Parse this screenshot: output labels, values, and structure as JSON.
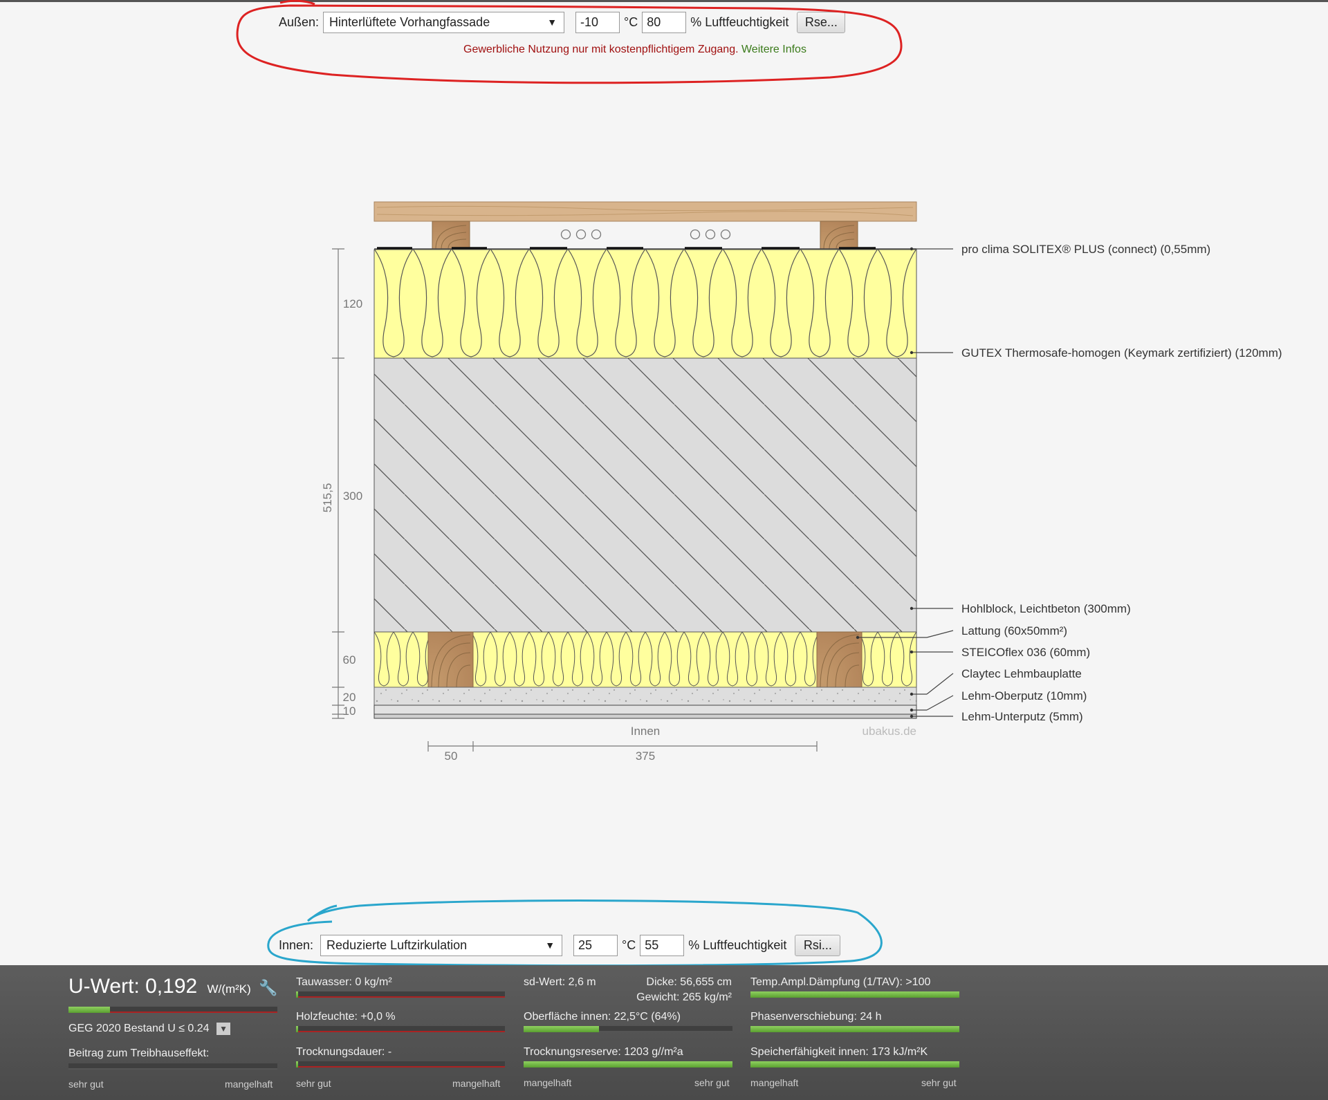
{
  "outside": {
    "label": "Außen:",
    "condition": "Hinterlüftete Vorhangfassade",
    "temperature": "-10",
    "temp_unit": "°C",
    "humidity": "80",
    "humidity_label": "% Luftfeuchtigkeit",
    "button": "Rse..."
  },
  "notice": {
    "text": "Gewerbliche Nutzung nur mit kostenpflichtigem Zugang.",
    "link": "Weitere Infos"
  },
  "diagram": {
    "layers": [
      "pro clima SOLITEX® PLUS (connect) (0,55mm)",
      "GUTEX Thermosafe-homogen  (Keymark zertifiziert) (120mm)",
      "Hohlblock, Leichtbeton (300mm)",
      "Lattung (60x50mm²)",
      "STEICOflex 036 (60mm)",
      "Claytec Lehmbauplatte",
      "Lehm-Oberputz (10mm)",
      "Lehm-Unterputz (5mm)"
    ],
    "dims_vertical": {
      "total": "515,5",
      "d120": "120",
      "d300": "300",
      "d60": "60",
      "d20": "20",
      "d10": "10"
    },
    "dims_horizontal": {
      "d50": "50",
      "d375": "375"
    },
    "inside_label": "Innen",
    "watermark": "ubakus.de"
  },
  "inside": {
    "label": "Innen:",
    "condition": "Reduzierte Luftzirkulation",
    "temperature": "25",
    "temp_unit": "°C",
    "humidity": "55",
    "humidity_label": "% Luftfeuchtigkeit",
    "button": "Rsi..."
  },
  "results": {
    "uwert_label": "U-Wert:",
    "uwert_value": "0,192",
    "uwert_unit": "W/(m²K)",
    "uwert_fill": 0.2,
    "geg": "GEG 2020 Bestand U ≤ 0.24",
    "treibhaus": "Beitrag zum Treibhauseffekt:",
    "tauwasser": "Tauwasser: 0 kg/m²",
    "holzfeuchte": "Holzfeuchte: +0,0 %",
    "trocknungsdauer": "Trocknungsdauer: -",
    "sdwert": "sd-Wert: 2,6 m",
    "dicke": "Dicke: 56,655 cm",
    "gewicht": "Gewicht: 265 kg/m²",
    "oberflaeche": "Oberfläche innen: 22,5°C (64%)",
    "oberflaeche_fill": 0.36,
    "trocknungsreserve": "Trocknungsreserve: 1203 g//m²a",
    "trocknungsreserve_fill": 1.0,
    "tav": "Temp.Ampl.Dämpfung (1/TAV): >100",
    "tav_fill": 1.0,
    "phasen": "Phasenverschiebung: 24 h",
    "phasen_fill": 1.0,
    "speicher": "Speicherfähigkeit innen: 173 kJ/m²K",
    "speicher_fill": 1.0,
    "scale_good": "sehr gut",
    "scale_bad": "mangelhaft"
  }
}
